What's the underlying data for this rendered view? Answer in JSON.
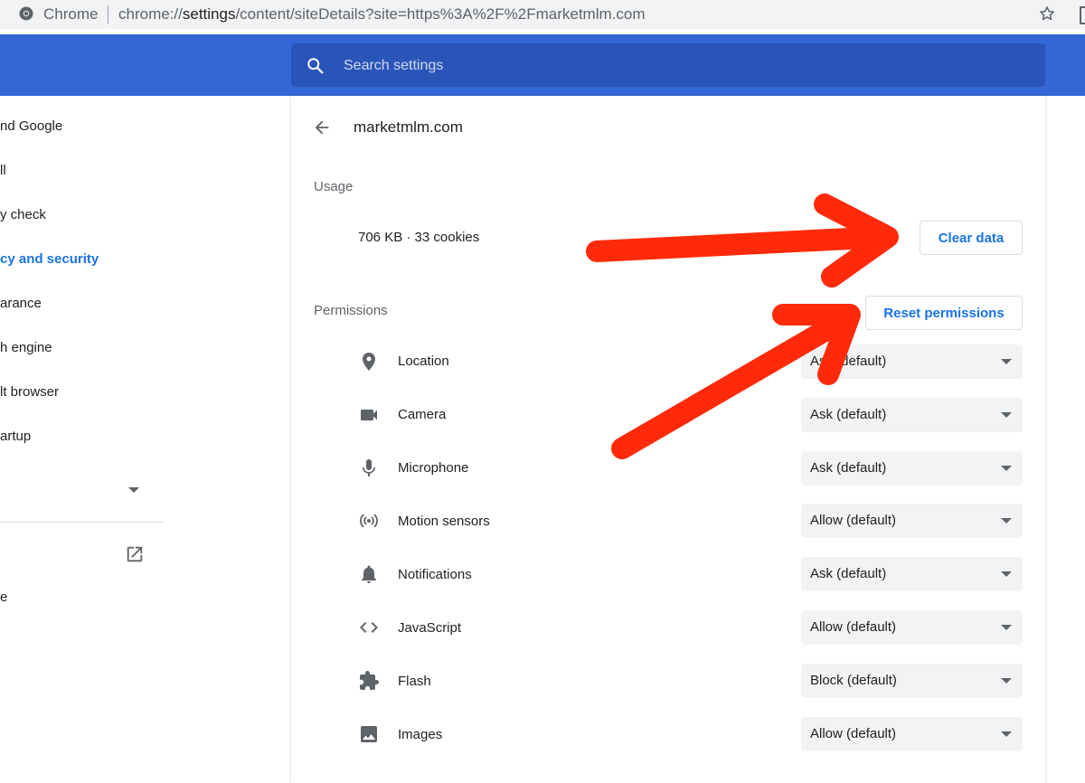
{
  "browser": {
    "name": "Chrome",
    "url_prefix": "chrome://",
    "url_host": "settings",
    "url_rest": "/content/siteDetails?site=https%3A%2F%2Fmarketmlm.com"
  },
  "search": {
    "placeholder": "Search settings"
  },
  "sidebar": {
    "items": [
      {
        "label": "nd Google"
      },
      {
        "label": "ll"
      },
      {
        "label": "y check"
      },
      {
        "label": "cy and security"
      },
      {
        "label": "arance"
      },
      {
        "label": "h engine"
      },
      {
        "label": "lt browser"
      },
      {
        "label": "artup"
      },
      {
        "label": "e"
      }
    ],
    "active_index": 3
  },
  "site": {
    "title": "marketmlm.com"
  },
  "usage": {
    "label": "Usage",
    "text": "706 KB · 33 cookies",
    "clear_button": "Clear data"
  },
  "permissions": {
    "label": "Permissions",
    "reset_button": "Reset permissions",
    "items": [
      {
        "label": "Location",
        "value": "Ask (default)",
        "icon": "location-pin-icon"
      },
      {
        "label": "Camera",
        "value": "Ask (default)",
        "icon": "camera-icon"
      },
      {
        "label": "Microphone",
        "value": "Ask (default)",
        "icon": "microphone-icon"
      },
      {
        "label": "Motion sensors",
        "value": "Allow (default)",
        "icon": "motion-sensors-icon"
      },
      {
        "label": "Notifications",
        "value": "Ask (default)",
        "icon": "bell-icon"
      },
      {
        "label": "JavaScript",
        "value": "Allow (default)",
        "icon": "code-icon"
      },
      {
        "label": "Flash",
        "value": "Block (default)",
        "icon": "puzzle-icon"
      },
      {
        "label": "Images",
        "value": "Allow (default)",
        "icon": "image-icon"
      }
    ]
  },
  "colors": {
    "header_blue": "#3367d6",
    "search_blue": "#2a55b8",
    "accent_blue": "#1a73e8",
    "annotation_red": "#ff2a0a"
  }
}
